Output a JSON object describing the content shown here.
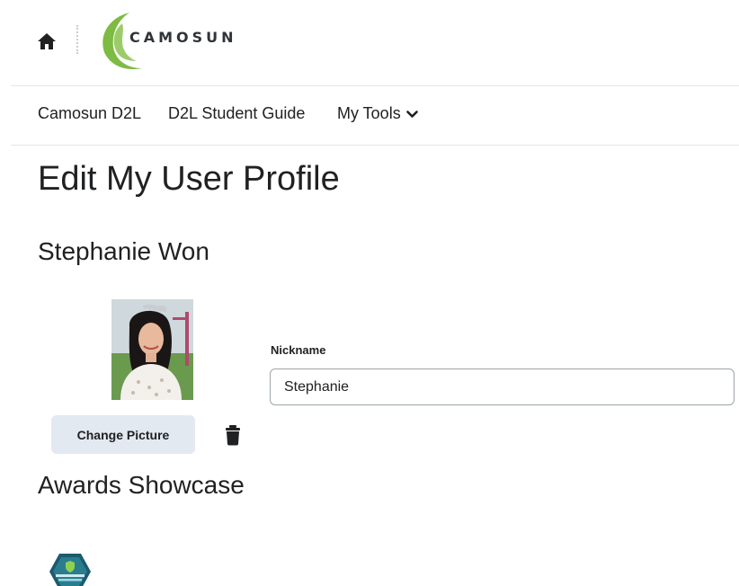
{
  "header": {
    "home_icon": "home-icon",
    "logo_text": "CAMOSUN",
    "logo_color": "#7dbb42"
  },
  "nav": {
    "items": [
      {
        "label": "Camosun D2L"
      },
      {
        "label": "D2L Student Guide"
      },
      {
        "label": "My Tools",
        "icon": "chevron-down-icon"
      }
    ]
  },
  "page": {
    "title": "Edit My User Profile",
    "user_name": "Stephanie Won"
  },
  "profile": {
    "change_picture_label": "Change Picture",
    "delete_icon": "trash-icon",
    "nickname_label": "Nickname",
    "nickname_value": "Stephanie"
  },
  "awards": {
    "heading": "Awards Showcase",
    "badge_icon": "academic-integrity-badge-icon",
    "badge_color": "#1d5a6e"
  }
}
